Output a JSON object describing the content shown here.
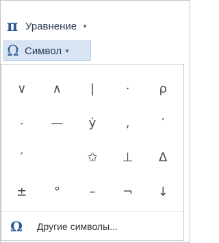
{
  "ribbon": {
    "equation": {
      "icon": "π",
      "icon_name": "pi-icon",
      "label": "Уравнение",
      "arrow": "▼"
    },
    "symbol": {
      "icon": "Ω",
      "icon_name": "omega-icon",
      "label": "Символ",
      "arrow": "▼"
    }
  },
  "symbols": [
    "∨",
    "∧",
    "|",
    "·",
    "ρ",
    "˗",
    "—",
    "ẏ",
    ",",
    "′",
    "′",
    "",
    "✩",
    "⊥",
    "∆",
    "±",
    "°",
    "–",
    "¬",
    "↓"
  ],
  "more": {
    "icon": "Ω",
    "icon_name": "omega-icon",
    "label": "Другие символы..."
  }
}
